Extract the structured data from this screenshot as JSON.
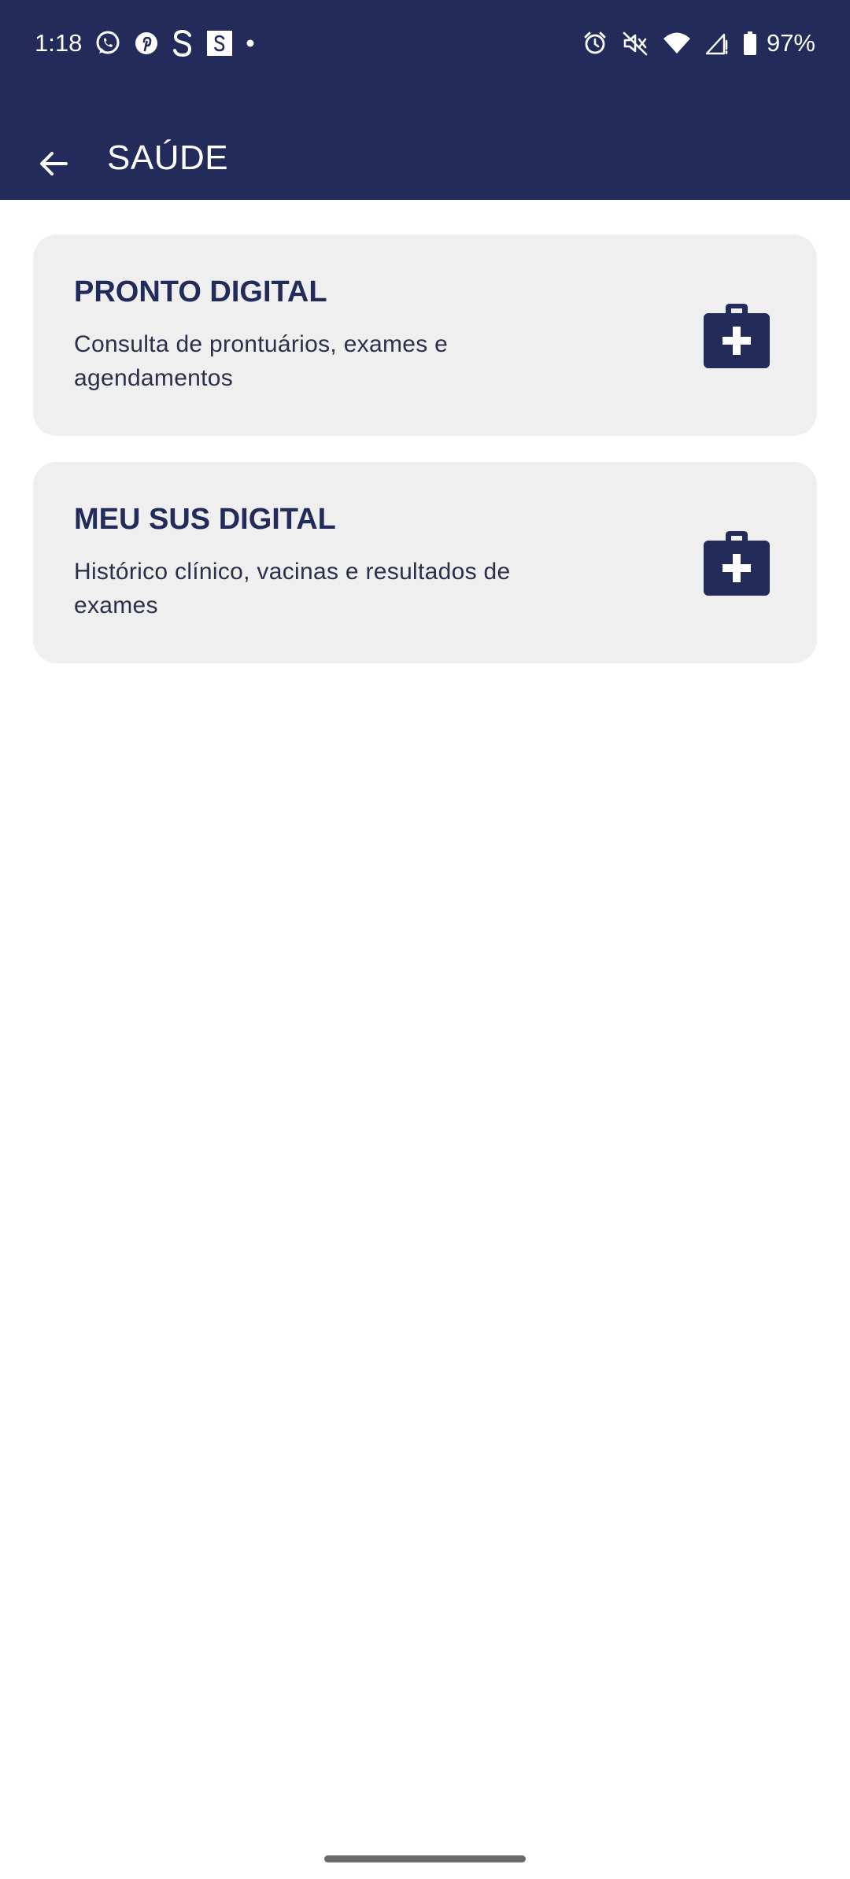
{
  "status_bar": {
    "time": "1:18",
    "battery": "97%",
    "left_icons": [
      "whatsapp-icon",
      "pinterest-icon",
      "s-icon",
      "s-square-icon",
      "dot-icon"
    ],
    "right_icons": [
      "alarm-icon",
      "mute-icon",
      "wifi-icon",
      "signal-icon",
      "battery-icon"
    ]
  },
  "header": {
    "title": "SAÚDE",
    "back_icon": "arrow-left-icon"
  },
  "cards": [
    {
      "title": "PRONTO DIGITAL",
      "description": "Consulta de prontuários, exames e agendamentos",
      "icon": "medical-kit-icon"
    },
    {
      "title": "MEU SUS DIGITAL",
      "description": "Histórico clínico, vacinas e resultados de exames",
      "icon": "medical-kit-icon"
    }
  ],
  "colors": {
    "primary": "#232b5a",
    "card_background": "#efeff0",
    "background": "#ffffff"
  }
}
